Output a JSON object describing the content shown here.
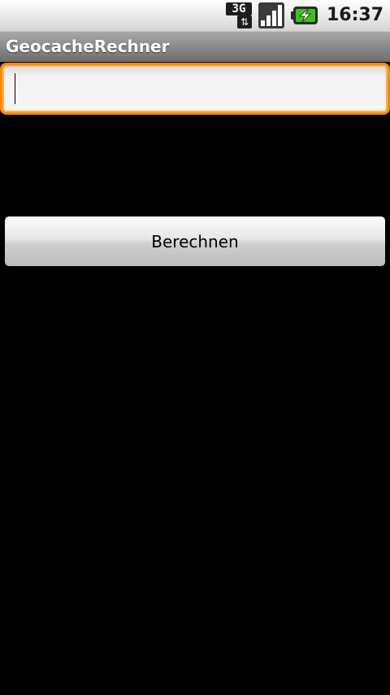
{
  "status_bar": {
    "network_type": "3G",
    "network_arrows": "⇅",
    "signal_icon": "signal-strength-icon",
    "battery_icon": "battery-charging-icon",
    "time": "16:37"
  },
  "app": {
    "title": "GeocacheRechner"
  },
  "input": {
    "value": "",
    "placeholder": "",
    "focused": true
  },
  "button": {
    "label": "Berechnen"
  },
  "colors": {
    "focus_border": "#ff8a00",
    "background": "#000000",
    "battery_green": "#3ec21b"
  }
}
